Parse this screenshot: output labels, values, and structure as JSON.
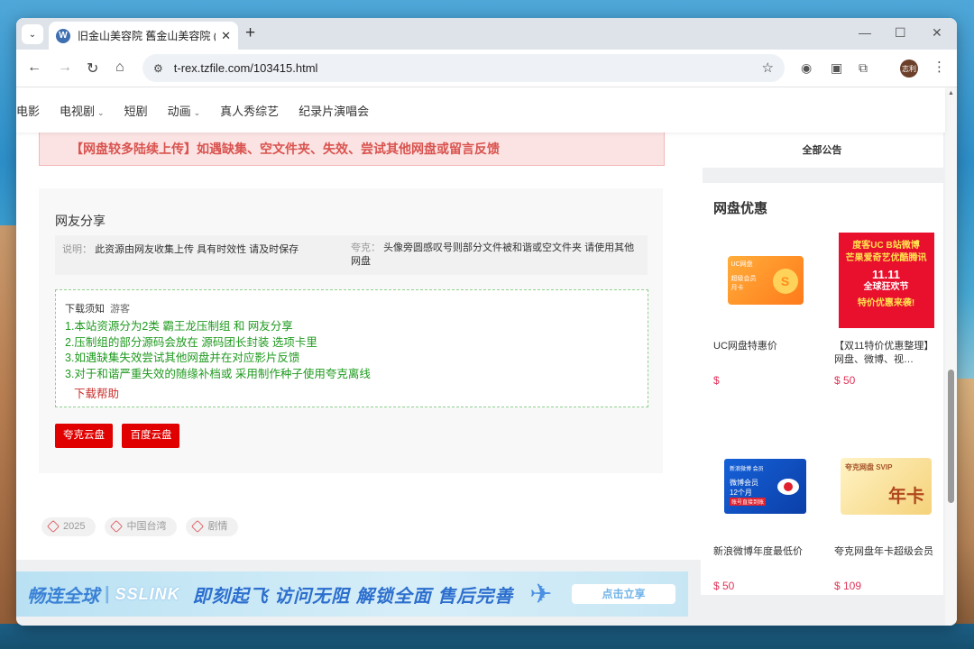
{
  "browser": {
    "tab_title": "旧金山美容院 舊金山美容院 (20",
    "favicon_label": "W",
    "url": "t-rex.tzfile.com/103415.html",
    "profile_initials": "志利"
  },
  "nav": {
    "items": [
      {
        "label": "电影",
        "dropdown": false
      },
      {
        "label": "电视剧",
        "dropdown": true
      },
      {
        "label": "短剧",
        "dropdown": false
      },
      {
        "label": "动画",
        "dropdown": true
      },
      {
        "label": "真人秀综艺",
        "dropdown": false
      },
      {
        "label": "纪录片演唱会",
        "dropdown": false
      }
    ]
  },
  "notice": "【网盘较多陆续上传】如遇缺集、空文件夹、失效、尝试其他网盘或留言反馈",
  "share": {
    "title": "网友分享",
    "note_label": "说明：",
    "note_text": "此资源由网友收集上传 具有时效性 请及时保存",
    "quark_label": "夸克：",
    "quark_text": "头像旁圆感叹号则部分文件被和谐或空文件夹 请使用其他网盘",
    "download_head": "下载须知",
    "guest": "游客",
    "lines": [
      "1.本站资源分为2类 霸王龙压制组 和 网友分享",
      "2.压制组的部分源码会放在 源码团长封装 选项卡里",
      "3.如遇缺集失效尝试其他网盘并在对应影片反馈",
      "3.对于和谐严重失效的随缘补档或 采用制作种子使用夸克离线"
    ],
    "help": "下载帮助",
    "buttons": [
      "夸克云盘",
      "百度云盘"
    ]
  },
  "tags": [
    "2025",
    "中国台湾",
    "剧情"
  ],
  "banner": {
    "brand": "畅连全球",
    "sub": "SSLINK",
    "slogan": "即刻起飞 访问无阻 解锁全面 售后完善",
    "cta": "点击立享"
  },
  "sidebar": {
    "announce": "全部公告",
    "deals_title": "网盘优惠",
    "deals": [
      {
        "name": "UC网盘特惠价",
        "price": "$"
      },
      {
        "name": "【双11特价优惠整理】网盘、微博、视…",
        "price": "$ 50"
      },
      {
        "name": "新浪微博年度最低价",
        "price": "$ 50"
      },
      {
        "name": "夸克网盘年卡超级会员",
        "price": "$ 109"
      }
    ],
    "uc_card": {
      "top": "UC网盘",
      "line1": "超级会员",
      "line2": "月卡",
      "badge": "S"
    },
    "promo": {
      "line1": "度客UC B站微博",
      "line2": "芒果爱奇艺优酷腾讯",
      "line3": "11.11",
      "line4": "全球狂欢节",
      "line5": "特价优惠来袭!"
    },
    "weibo_card": {
      "top": "新浪微博 会员",
      "line1": "微博会员",
      "line2": "12个月",
      "tag": "账号直接到账"
    },
    "svip_card": {
      "top": "夸克网盘 SVIP",
      "big": "年卡"
    }
  },
  "colors": {
    "accent_red": "#e00000",
    "notice_bg": "#fbe3e3",
    "green_text": "#1f9a1f",
    "price_pink": "#e0355a"
  }
}
